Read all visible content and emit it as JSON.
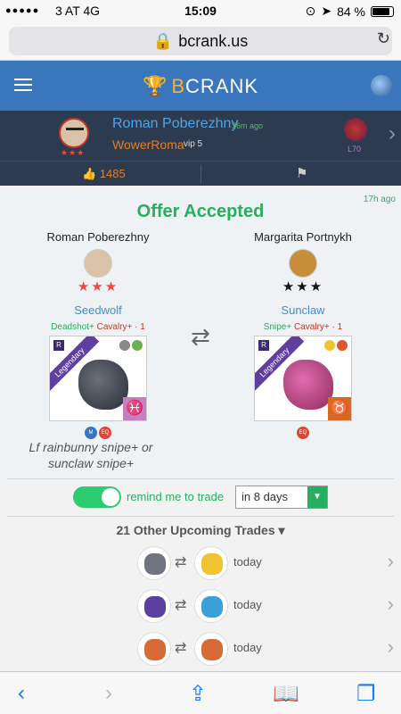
{
  "status": {
    "signal": "●●●●●",
    "carrier": "3 AT 4G",
    "time": "15:09",
    "battery": "84 %"
  },
  "browser": {
    "url": "bcrank.us"
  },
  "site": {
    "logo_prefix": "B",
    "logo_rest": "CRANK"
  },
  "profile": {
    "name": "Roman Poberezhny",
    "time_ago": "36m ago",
    "guild": "WowerRoma",
    "vip": "vip 5",
    "stars": "★★★",
    "level": "L70",
    "likes": "1485"
  },
  "offer": {
    "time_ago": "17h ago",
    "title": "Offer Accepted",
    "left": {
      "user": "Roman Poberezhny",
      "stars": "★★★",
      "dragon": "Seedwolf",
      "trait1": "Deadshot+",
      "trait2": "Cavalry+ · 1",
      "rarity": "Legendary",
      "rank_badge": "R",
      "zodiac": "♓",
      "chips": [
        "M",
        "EQ"
      ]
    },
    "right": {
      "user": "Margarita Portnykh",
      "stars": "★★★",
      "dragon": "Sunclaw",
      "trait1": "Snipe+",
      "trait2": "Cavalry+ · 1",
      "rarity": "Legendary",
      "rank_badge": "R",
      "zodiac": "♉",
      "chips": [
        "EQ"
      ]
    },
    "note": "Lf rainbunny snipe+ or sunclaw snipe+"
  },
  "remind": {
    "label": "remind me to trade",
    "selected": "in 8 days"
  },
  "upcoming": {
    "title": "21 Other Upcoming Trades ▾",
    "trades": [
      {
        "when": "today",
        "c1": "#6f7480",
        "c2": "#f1c232"
      },
      {
        "when": "today",
        "c1": "#5b3fa0",
        "c2": "#3aa0d8"
      },
      {
        "when": "today",
        "c1": "#d86a3a",
        "c2": "#d86a3a"
      }
    ]
  },
  "colors": {
    "header": "#3a76bc",
    "profile_bg": "#2c3b4f",
    "accent_green": "#27ae60"
  }
}
